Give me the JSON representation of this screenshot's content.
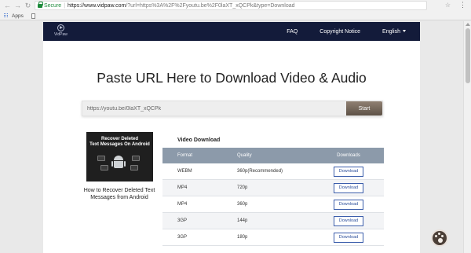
{
  "browser": {
    "secure_label": "Secure",
    "url_host": "https://www.vidpaw.com",
    "url_path": "/?url=https%3A%2F%2Fyoutu.be%2F0laXT_xQCPk&type=Download",
    "bookmarks_apps": "Apps"
  },
  "site": {
    "logo_text": "VidPaw",
    "nav": {
      "faq": "FAQ",
      "copyright": "Copyright Notice",
      "language": "English"
    }
  },
  "hero": {
    "headline": "Paste URL Here to Download Video & Audio",
    "input_value": "https://youtu.be/0laXT_xQCPk",
    "start_label": "Start"
  },
  "video": {
    "thumb_title_line1": "Recover Deleted",
    "thumb_title_line2": "Text Messages On Android",
    "caption": "How to Recover Deleted Text Messages from Android"
  },
  "downloads": {
    "section_title": "Video Download",
    "headers": [
      "Format",
      "Quality",
      "Downloads"
    ],
    "rows": [
      {
        "format": "WEBM",
        "quality": "360p(Recommended)",
        "action": "Download"
      },
      {
        "format": "MP4",
        "quality": "720p",
        "action": "Download"
      },
      {
        "format": "MP4",
        "quality": "360p",
        "action": "Download"
      },
      {
        "format": "3GP",
        "quality": "144p",
        "action": "Download"
      },
      {
        "format": "3GP",
        "quality": "180p",
        "action": "Download"
      }
    ]
  },
  "colors": {
    "header_bg": "#131b3a",
    "table_header": "#8c9aaa",
    "download_border": "#3b5dab",
    "start_button": "#6e6155",
    "secure_green": "#1c8a3a"
  }
}
